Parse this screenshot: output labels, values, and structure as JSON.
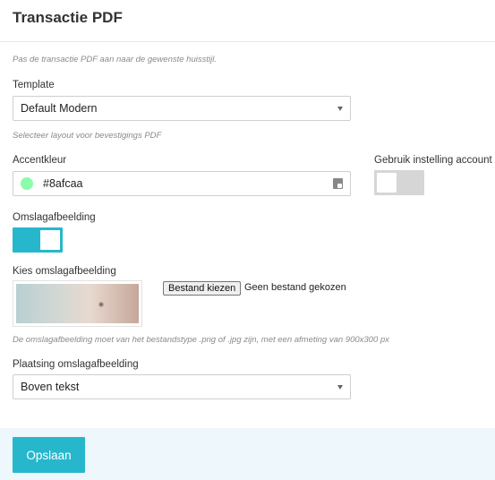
{
  "header": {
    "title": "Transactie PDF"
  },
  "intro": "Pas de transactie PDF aan naar de gewenste huisstijl.",
  "template": {
    "label": "Template",
    "value": "Default Modern",
    "help": "Selecteer layout voor bevestigings PDF"
  },
  "accent": {
    "label": "Accentkleur",
    "value": "#8afcaa",
    "swatch_color": "#8afcaa",
    "account_label": "Gebruik instelling account",
    "account_toggle_on": false
  },
  "cover": {
    "label": "Omslagafbeelding",
    "toggle_on": true,
    "choose_label": "Kies omslagafbeelding",
    "file_button": "Bestand kiezen",
    "file_status": "Geen bestand gekozen",
    "help": "De omslagafbeelding moet van het bestandstype .png of .jpg zijn, met een afmeting van 900x300 px"
  },
  "placement": {
    "label": "Plaatsing omslagafbeelding",
    "value": "Boven tekst"
  },
  "footer": {
    "save_label": "Opslaan"
  },
  "colors": {
    "accent": "#27b7cc",
    "footer_bg": "#eef7fb"
  }
}
